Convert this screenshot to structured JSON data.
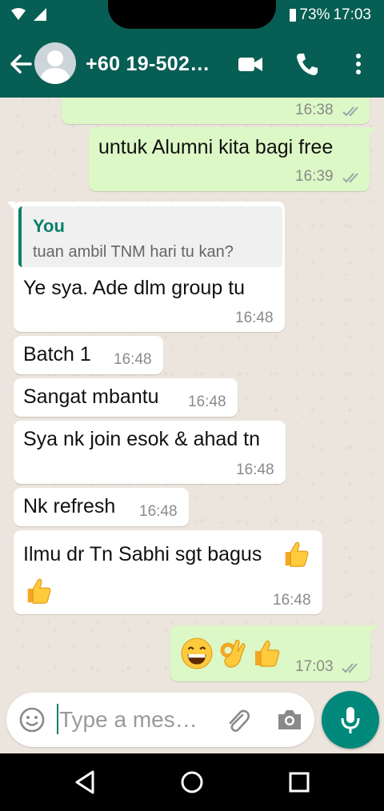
{
  "status_bar": {
    "battery": "73%",
    "time": "17:03"
  },
  "header": {
    "contact": "+60 19-502…"
  },
  "messages": {
    "m1": {
      "time": "16:38"
    },
    "m2": {
      "text": "untuk Alumni kita bagi free",
      "time": "16:39"
    },
    "m3": {
      "quote_author": "You",
      "quote_text": "tuan ambil TNM hari tu kan?",
      "text": "Ye sya. Ade dlm group tu",
      "time": "16:48"
    },
    "m4": {
      "text": "Batch 1",
      "time": "16:48"
    },
    "m5": {
      "text": "Sangat mbantu",
      "time": "16:48"
    },
    "m6": {
      "text": "Sya nk join esok & ahad tn",
      "time": "16:48"
    },
    "m7": {
      "text": "Nk refresh",
      "time": "16:48"
    },
    "m8": {
      "text": "Ilmu dr Tn Sabhi sgt bagus",
      "time": "16:48"
    },
    "m9": {
      "time": "17:03"
    }
  },
  "input": {
    "placeholder": "Type a mes…"
  },
  "colors": {
    "header": "#075E54",
    "outgoing": "#DCF8C6",
    "incoming": "#FFFFFF",
    "accent": "#00897B",
    "read_ticks": "#9aa5a8"
  }
}
